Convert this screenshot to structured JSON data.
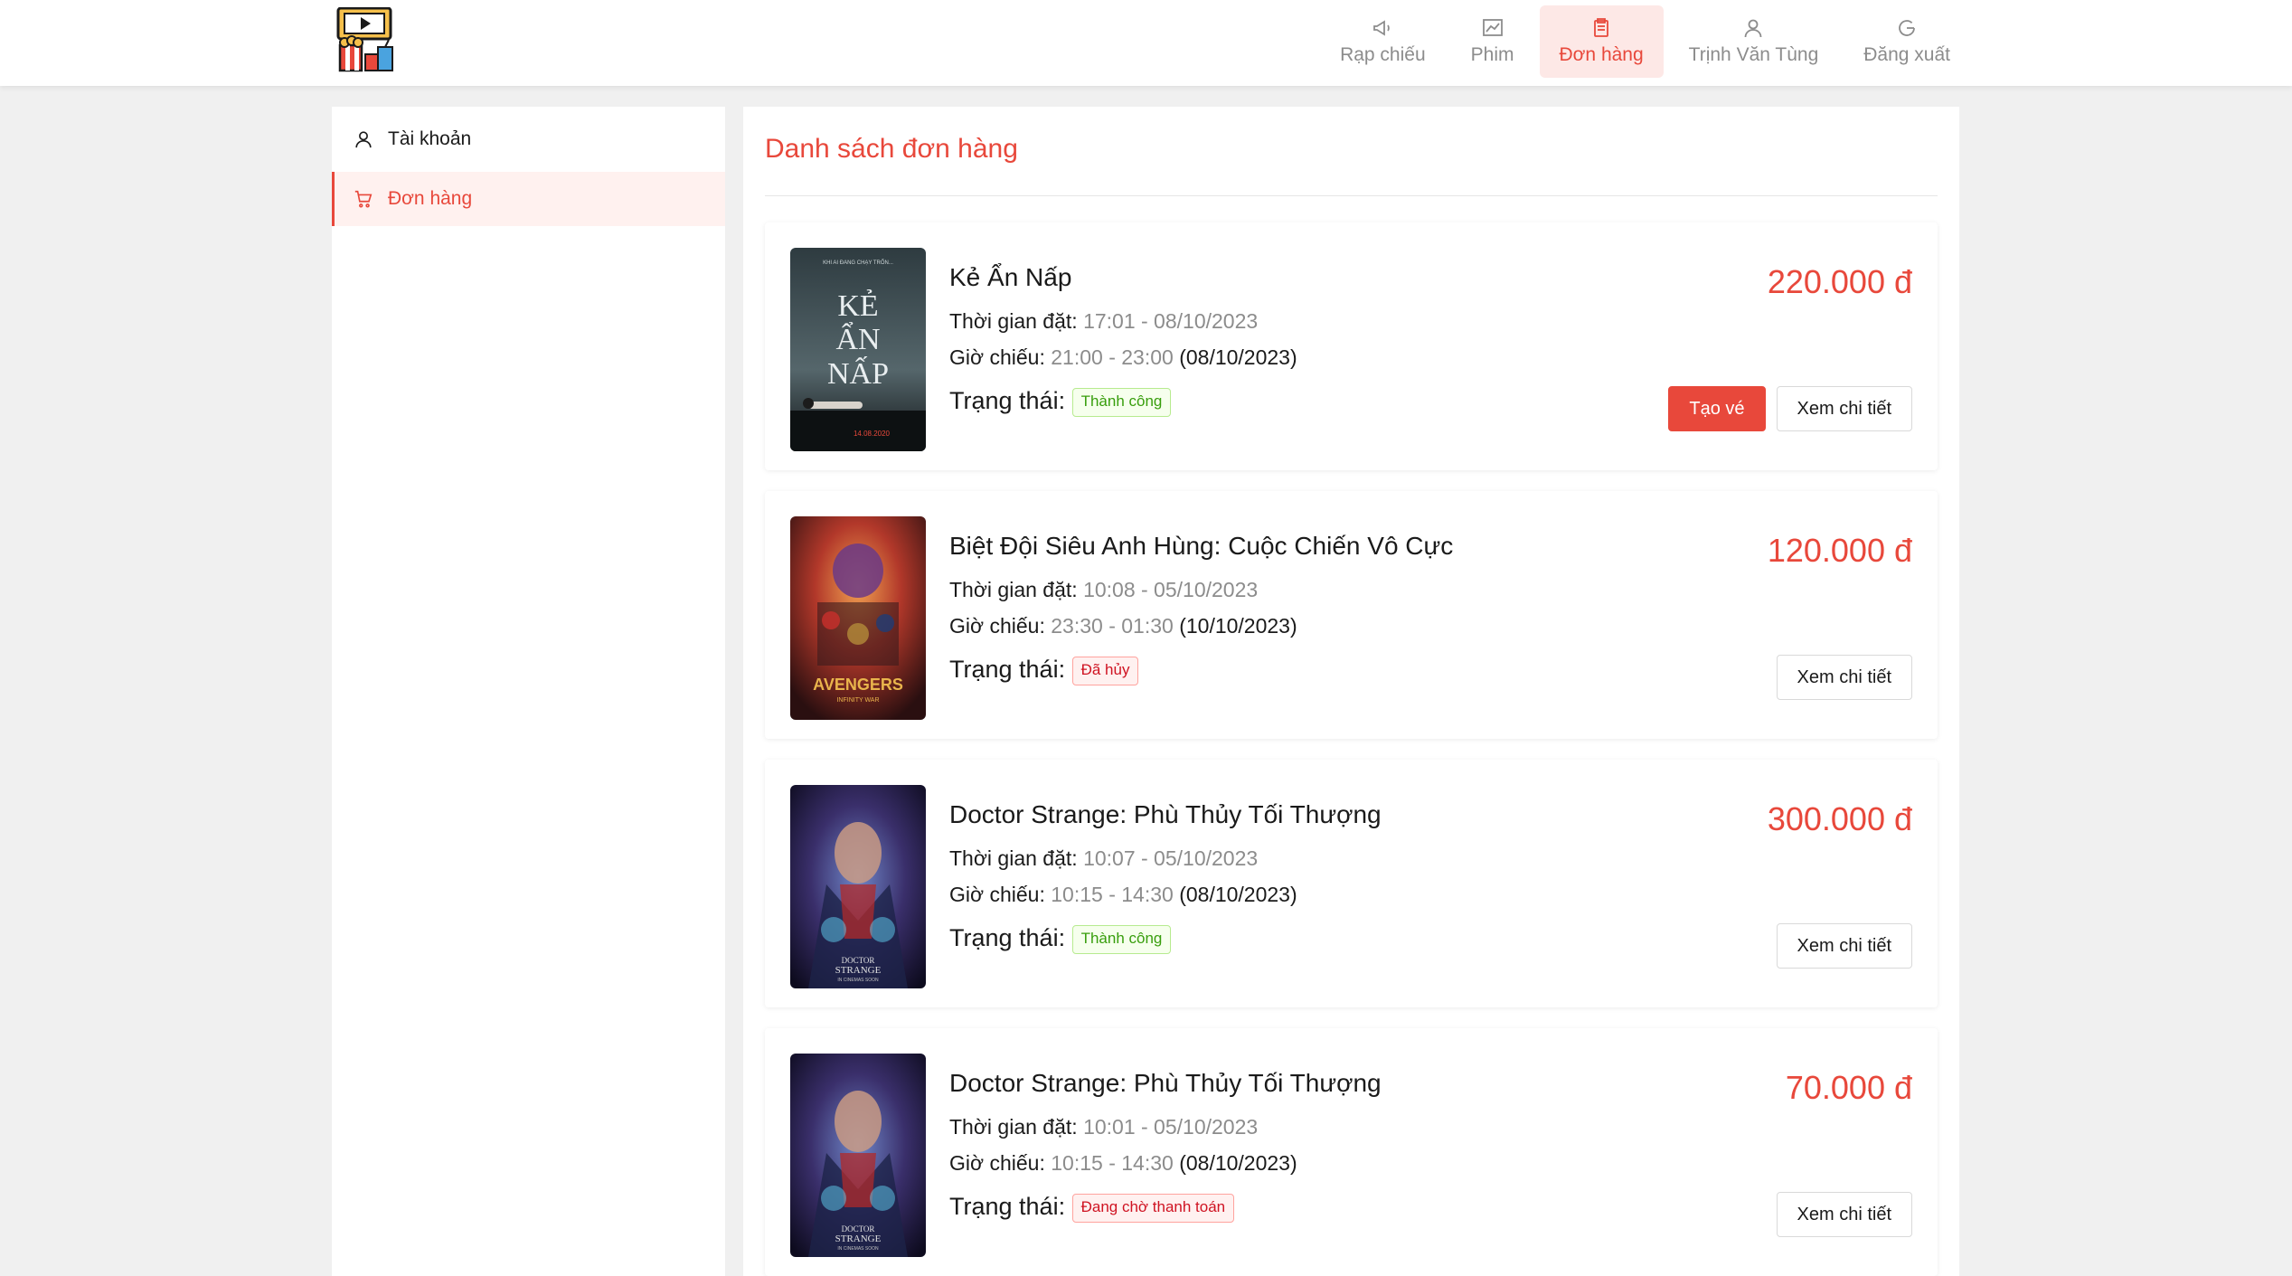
{
  "header": {
    "logo_icon": "cinema-popcorn-logo",
    "nav": [
      {
        "label": "Rạp chiếu",
        "icon": "megaphone-icon"
      },
      {
        "label": "Phim",
        "icon": "chart-line-icon"
      },
      {
        "label": "Đơn hàng",
        "icon": "receipt-icon",
        "active": true
      },
      {
        "label": "Trịnh Văn Tùng",
        "icon": "user-icon"
      },
      {
        "label": "Đăng xuất",
        "icon": "logout-icon"
      }
    ]
  },
  "sidebar": {
    "items": [
      {
        "label": "Tài khoản",
        "icon": "user-icon"
      },
      {
        "label": "Đơn hàng",
        "icon": "cart-icon",
        "active": true
      }
    ]
  },
  "main": {
    "title": "Danh sách đơn hàng",
    "labels": {
      "booked_time": "Thời gian đặt:",
      "showtime": "Giờ chiếu:",
      "status": "Trạng thái:",
      "create_ticket": "Tạo vé",
      "view_detail": "Xem chi tiết"
    },
    "orders": [
      {
        "title": "Kẻ Ẩn Nấp",
        "booked": "17:01 - 08/10/2023",
        "show_time": "21:00 - 23:00",
        "show_date": "(08/10/2023)",
        "status": "Thành công",
        "status_type": "success",
        "price": "220.000 đ",
        "poster": "poster-ke-an-nap"
      },
      {
        "title": "Biệt Đội Siêu Anh Hùng: Cuộc Chiến Vô Cực",
        "booked": "10:08 - 05/10/2023",
        "show_time": "23:30 - 01:30",
        "show_date": "(10/10/2023)",
        "status": "Đã hủy",
        "status_type": "error",
        "price": "120.000 đ",
        "poster": "poster-avengers"
      },
      {
        "title": "Doctor Strange: Phù Thủy Tối Thượng",
        "booked": "10:07 - 05/10/2023",
        "show_time": "10:15 - 14:30",
        "show_date": "(08/10/2023)",
        "status": "Thành công",
        "status_type": "success",
        "price": "300.000 đ",
        "poster": "poster-doctor-strange"
      },
      {
        "title": "Doctor Strange: Phù Thủy Tối Thượng",
        "booked": "10:01 - 05/10/2023",
        "show_time": "10:15 - 14:30",
        "show_date": "(08/10/2023)",
        "status": "Đang chờ thanh toán",
        "status_type": "error",
        "price": "70.000 đ",
        "poster": "poster-doctor-strange"
      }
    ]
  },
  "poster_text": {
    "ke_an_nap": {
      "tagline": "KHI AI ĐANG CHẠY TRỐN...",
      "title_l1": "KẺ",
      "title_l2": "ẨN",
      "title_l3": "NẤP",
      "date": "14.08.2020"
    },
    "avengers": {
      "title": "AVENGERS",
      "subtitle": "INFINITY WAR"
    },
    "doctor_strange": {
      "title_l1": "DOCTOR",
      "title_l2": "STRANGE",
      "subtitle": "IN CINEMAS SOON"
    }
  },
  "colors": {
    "accent": "#e8483b",
    "success": "#389e0d",
    "error": "#cf1322"
  }
}
